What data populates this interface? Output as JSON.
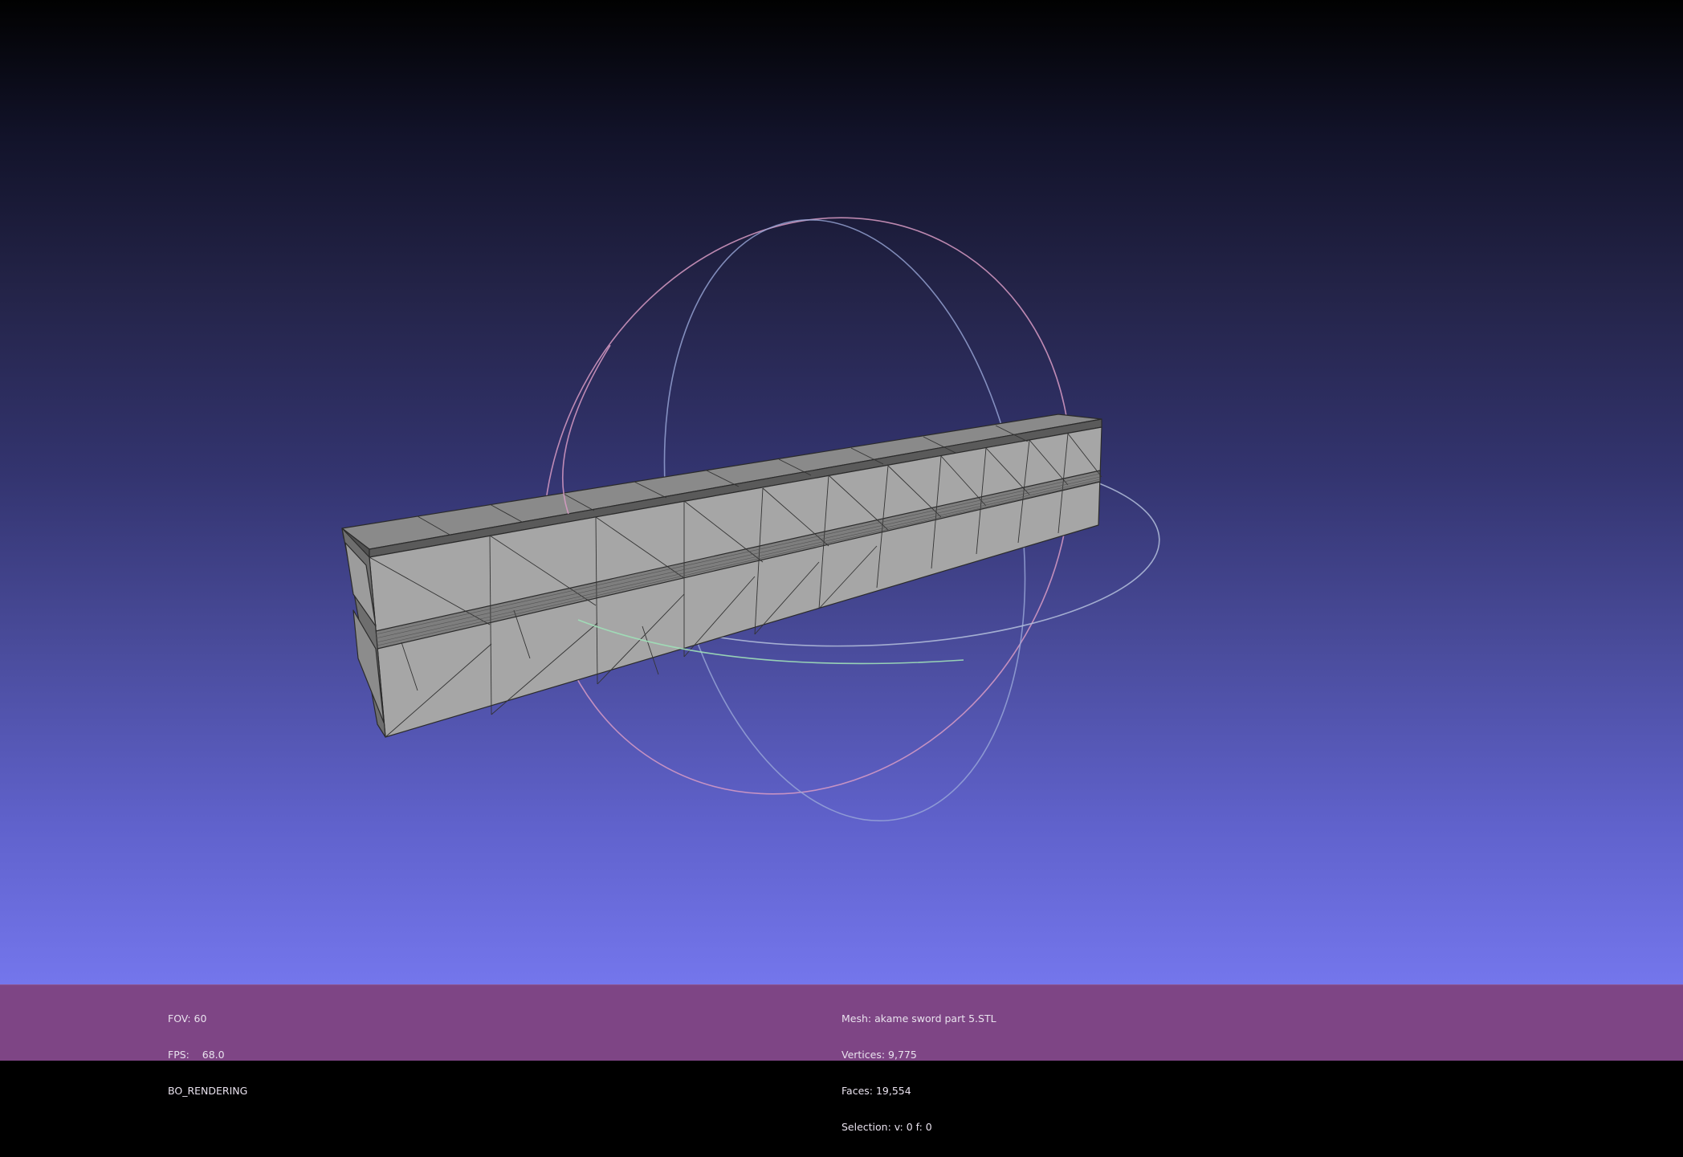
{
  "viewport": {
    "mesh_color": "#9d9d9d",
    "edge_color": "#2a2a2a",
    "background_top": "#010101",
    "background_bottom": "#7476ec",
    "trackball_colors": [
      "#e4a0c8",
      "#9aa8d8",
      "#a0e0b8"
    ]
  },
  "status_bar": {
    "color": "#7e4585",
    "render_info": {
      "fov": "FOV: 60",
      "fps": "FPS:    68.0",
      "mode": "BO_RENDERING"
    },
    "mesh_info": {
      "mesh": "Mesh: akame sword part 5.STL",
      "vertices": "Vertices: 9,775",
      "faces": "Faces: 19,554",
      "selection": "Selection: v: 0 f: 0"
    }
  }
}
